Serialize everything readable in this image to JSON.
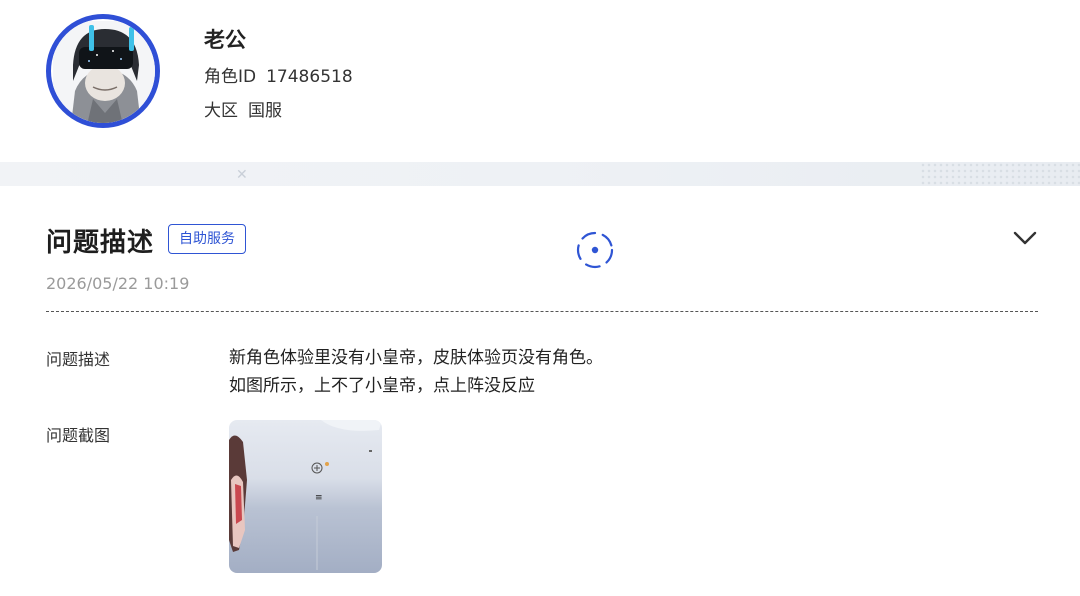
{
  "profile": {
    "nickname": "老公",
    "role_id_label": "角色ID",
    "role_id": "17486518",
    "region_label": "大区",
    "region": "国服",
    "avatar_ring_color": "#2f4fd6"
  },
  "section": {
    "title": "问题描述",
    "badge": "自助服务",
    "date": "2026/05/22 10:19",
    "loader_icon": "spinner-icon",
    "toggle_icon": "chevron-down-icon",
    "accent_color": "#2f55d4"
  },
  "details": {
    "desc_label": "问题描述",
    "desc_line1": "新角色体验里没有小皇帝，皮肤体验页没有角色。",
    "desc_line2": "如图所示，上不了小皇帝，点上阵没反应",
    "screenshot_label": "问题截图",
    "screenshot_icon": "screenshot-thumbnail"
  }
}
